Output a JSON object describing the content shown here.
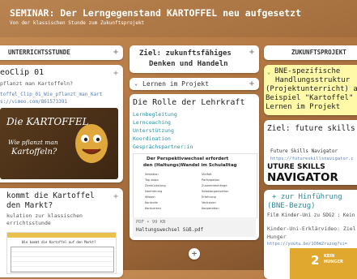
{
  "header": {
    "title": "SEMINAR: Der Lerngegenstand KARTOFFEL neu aufgesetzt",
    "subtitle": "Von der klassischen Stunde zum Zukunftsprojekt"
  },
  "columns": {
    "left_title": "UNTERRICHTSSTUNDE",
    "middle_title_1": "Ziel: zukunftsfähiges",
    "middle_title_2": "Denken und Handeln",
    "right_title": "ZUKUNFTSPROJEKT"
  },
  "left": {
    "card1": {
      "title": "eoClip 01",
      "subtitle": "pflanzt man Kartoffeln?",
      "file": "toffel_Clip_01_Wie_pflanzt_man_Kart",
      "url": "s://vimeo.com/861573391",
      "image_heading": "Die KARTOFFEL",
      "image_question_1": "Wie pflanzt man",
      "image_question_2": "Kartoffeln?"
    },
    "card2": {
      "title_1": "kommt die Kartoffel",
      "title_2": "den Markt?",
      "subtitle_1": "kulation zur klassischen",
      "subtitle_2": "errichtsstunde",
      "doc_header": "Wie kommt die Kartoffel auf den Markt?"
    }
  },
  "middle": {
    "section_label": "Lernen im Projekt",
    "card": {
      "title": "Die Rolle der Lehrkraft",
      "lines": [
        "Lernbegleitung",
        "Lerncoaching",
        "Unterstützung",
        "Koordination",
        "Gesprächspartner:in"
      ],
      "doc_title_1": "Der Perspektivwechsel erfordert",
      "doc_title_2": "den (Haltungs)Wandel im Schulalltag",
      "doc_left": [
        "Selektion",
        "Top down",
        "Zerstückelung",
        "Normierung",
        "Wissen",
        "Kontrolle",
        "Konkurrenz"
      ],
      "doc_right": [
        "Vielfalt",
        "Partizipation",
        "Zusammenhänge",
        "Selbstorganisation",
        "Erfahrung",
        "Vertrauen",
        "Kooperation"
      ],
      "file_meta": "PDF • 99 KB",
      "file_name": "Haltungswechsel Süß.pdf"
    }
  },
  "right": {
    "card1": {
      "lines": [
        "BNE-spezifische",
        "Handlungsstruktur",
        "(Projektunterricht) a",
        "Beispiel \"Kartoffel\"",
        "Lernen im Projekt"
      ]
    },
    "card2": {
      "title": "Ziel: future skills",
      "link_title": "Future Skills Navigator",
      "link_url": "https://futureskillsnavigator.c",
      "logo_top": "UTURE SKILLS",
      "logo_bottom": "NAVIGATOR"
    },
    "card3": {
      "title_1": "+ zur Hinführung",
      "title_2": "(BNE-Bezug)",
      "subtitle": "Film Kinder-Uni zu SDG2 : Kein",
      "desc_1": "Kinder-Uni-Erklärvideo: Ziel",
      "desc_2": "Hunger",
      "url": "https://youtu.be/1O6m2ruzog?si=",
      "badge_number": "2",
      "badge_line1": "KEIN",
      "badge_line2": "HUNGER"
    }
  },
  "colors": {
    "accent_yellow": "#fff9a8",
    "teal": "#2b8a9a",
    "sdg_gold": "#e0a82e"
  }
}
